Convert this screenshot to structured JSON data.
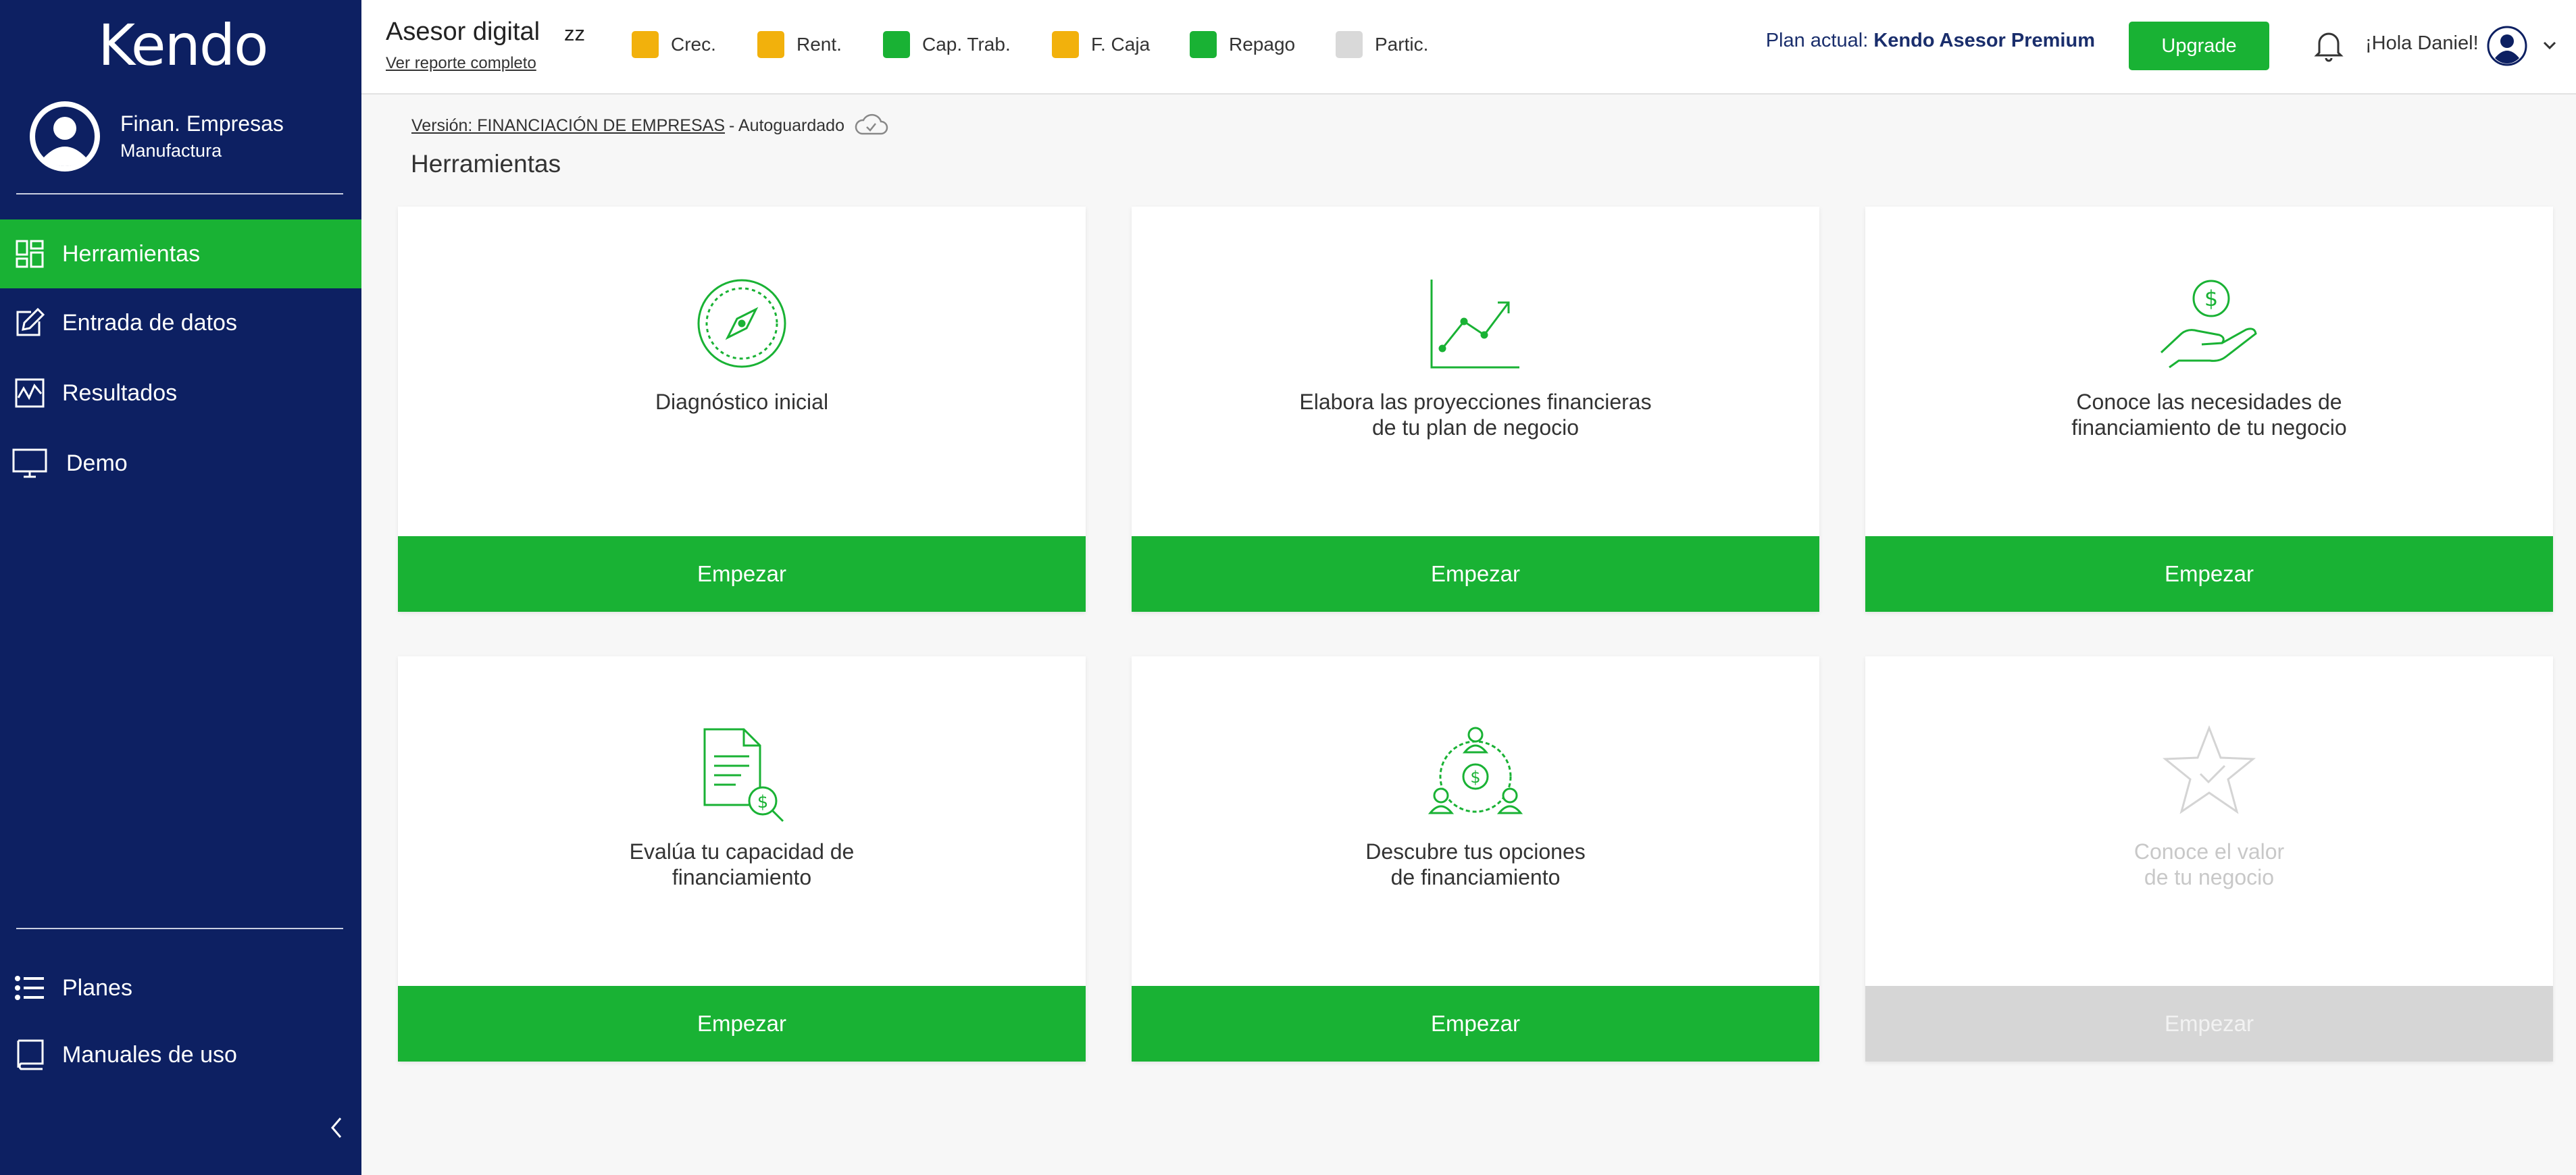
{
  "app": {
    "logo": "Kendo"
  },
  "sidebar": {
    "profile": {
      "name": "Finan. Empresas",
      "subtitle": "Manufactura"
    },
    "items": [
      {
        "label": "Herramientas",
        "icon": "dashboard-icon",
        "active": true
      },
      {
        "label": "Entrada de datos",
        "icon": "edit-icon"
      },
      {
        "label": "Resultados",
        "icon": "chart-icon"
      },
      {
        "label": "Demo",
        "icon": "monitor-icon"
      }
    ],
    "bottom_items": [
      {
        "label": "Planes",
        "icon": "list-icon"
      },
      {
        "label": "Manuales de uso",
        "icon": "book-icon"
      }
    ]
  },
  "header": {
    "title": "Asesor digital",
    "code": "zz",
    "report_link": "Ver reporte completo",
    "indicators": [
      {
        "label": "Crec.",
        "color": "#f2b10c"
      },
      {
        "label": "Rent.",
        "color": "#f2b10c"
      },
      {
        "label": "Cap. Trab.",
        "color": "#19b234"
      },
      {
        "label": "F. Caja",
        "color": "#f2b10c"
      },
      {
        "label": "Repago",
        "color": "#19b234"
      },
      {
        "label": "Partic.",
        "color": "#d9d9d9"
      }
    ],
    "plan_label": "Plan actual:",
    "plan_name": "Kendo Asesor Premium",
    "upgrade_label": "Upgrade",
    "greeting": "¡Hola Daniel!"
  },
  "main": {
    "version_link": "Versión: FINANCIACIÓN DE EMPRESAS",
    "version_status": "- Autoguardado",
    "section_title": "Herramientas",
    "cards": [
      {
        "text": "Diagnóstico inicial",
        "button": "Empezar",
        "icon": "compass-icon"
      },
      {
        "text": "Elabora las proyecciones financieras\nde tu plan de negocio",
        "button": "Empezar",
        "icon": "growth-chart-icon"
      },
      {
        "text": "Conoce las necesidades de\nfinanciamiento de tu negocio",
        "button": "Empezar",
        "icon": "hand-coin-icon"
      },
      {
        "text": "Evalúa tu capacidad de\nfinanciamiento",
        "button": "Empezar",
        "icon": "document-dollar-icon"
      },
      {
        "text": "Descubre tus opciones\nde financiamiento",
        "button": "Empezar",
        "icon": "people-money-icon"
      },
      {
        "text": "Conoce el valor\nde tu negocio",
        "button": "Empezar",
        "icon": "star-check-icon",
        "disabled": true
      }
    ]
  },
  "colors": {
    "sidebar": "#0d2062",
    "accent": "#19b234",
    "warning": "#f2b10c",
    "neutral": "#d9d9d9"
  }
}
